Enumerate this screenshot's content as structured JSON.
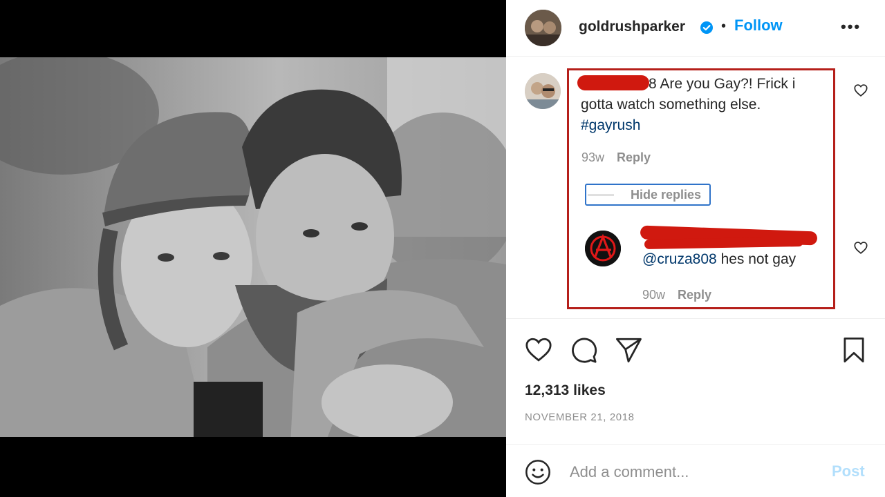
{
  "post": {
    "username": "goldrushparker",
    "follow_label": "Follow",
    "dot": "•",
    "more": "•••"
  },
  "comments": [
    {
      "username_suffix": "8",
      "text": "Are you Gay?! Frick i gotta watch something else.",
      "hashtag": "#gayrush",
      "age": "93w",
      "reply_label": "Reply"
    }
  ],
  "hide_replies_label": "Hide replies",
  "replies": [
    {
      "mention": "@cruza808",
      "text": "hes not gay",
      "age": "90w",
      "reply_label": "Reply"
    }
  ],
  "likes": "12,313 likes",
  "date": "NOVEMBER 21, 2018",
  "add_comment": {
    "placeholder": "Add a comment...",
    "post_label": "Post"
  },
  "colors": {
    "accent": "#0095f6",
    "annotation_box": "#b51f1a",
    "redaction": "#d0190f",
    "hide_replies_box": "#2f73c9"
  }
}
